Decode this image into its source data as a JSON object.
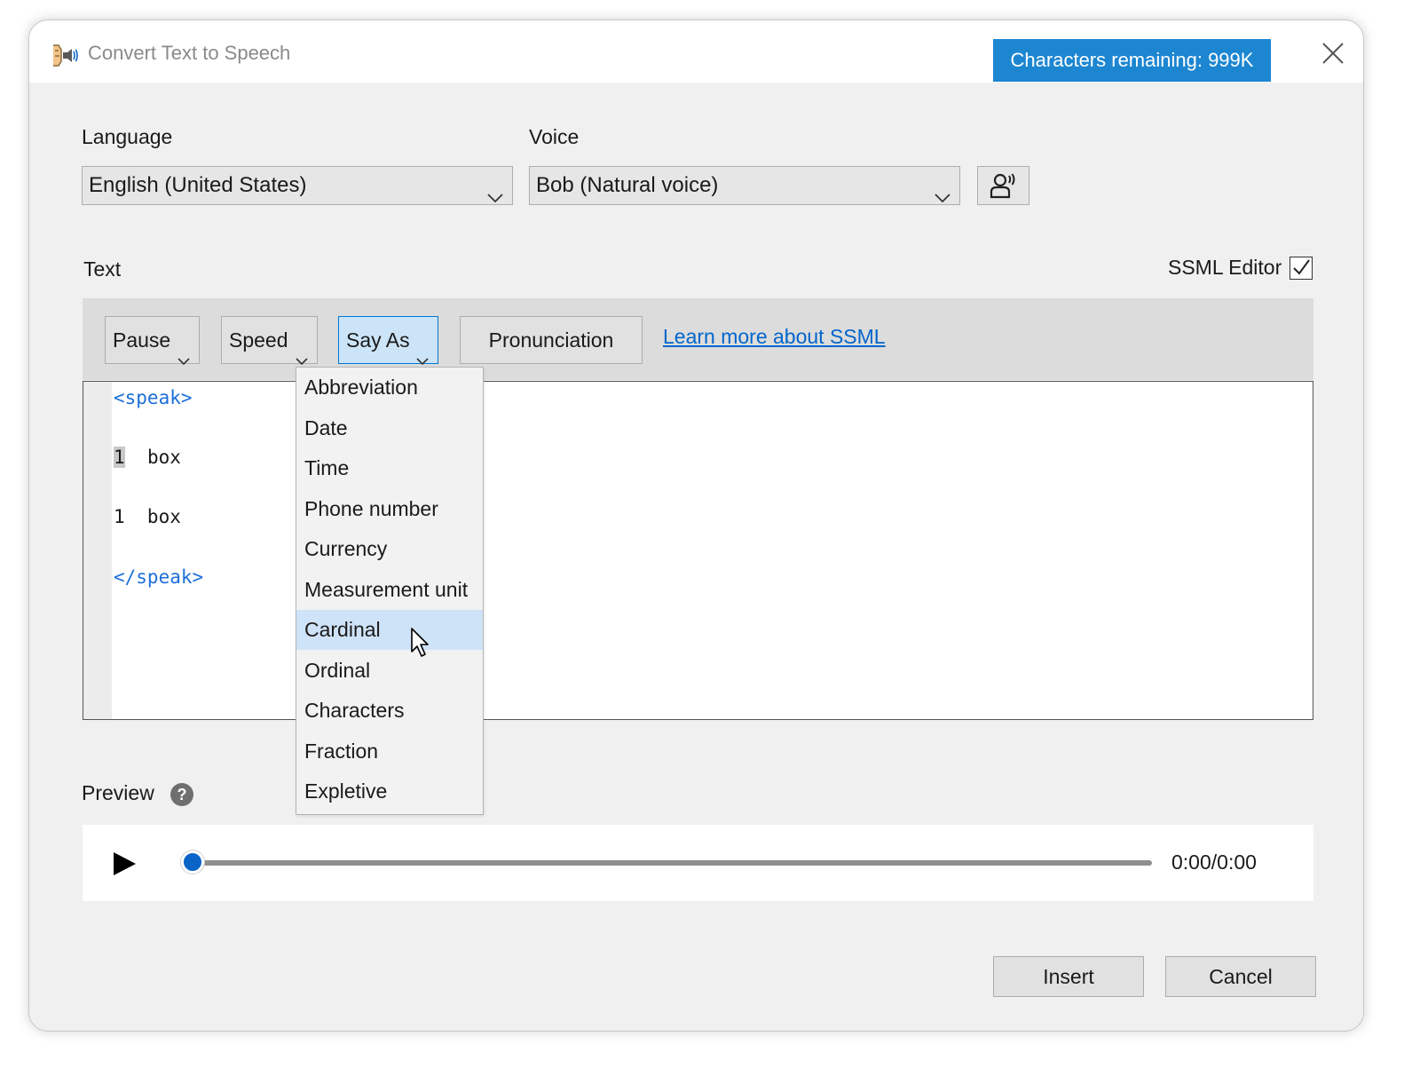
{
  "window": {
    "title": "Convert Text to Speech",
    "app_icon": "speaker-sound-icon",
    "characters_remaining": "Characters remaining: 999K",
    "close_icon": "close-icon"
  },
  "language": {
    "label": "Language",
    "selected": "English (United States)"
  },
  "voice": {
    "label": "Voice",
    "selected": "Bob (Natural voice)",
    "preview_icon": "voice-person-icon"
  },
  "text_section": {
    "label": "Text",
    "ssml_editor_label": "SSML Editor",
    "ssml_editor_checked": true
  },
  "toolbar": {
    "pause": "Pause",
    "speed": "Speed",
    "say_as": "Say As",
    "pronunciation": "Pronunciation",
    "learn_link": "Learn more about SSML"
  },
  "editor": {
    "lines": [
      "<speak>",
      "1",
      "box",
      "1  box",
      "</speak>"
    ]
  },
  "say_as_menu": {
    "items": [
      "Abbreviation",
      "Date",
      "Time",
      "Phone number",
      "Currency",
      "Measurement unit",
      "Cardinal",
      "Ordinal",
      "Characters",
      "Fraction",
      "Expletive"
    ],
    "hovered": "Cardinal"
  },
  "preview": {
    "label": "Preview",
    "help_icon": "question-icon",
    "time": "0:00/0:00",
    "progress": 0
  },
  "footer": {
    "insert": "Insert",
    "cancel": "Cancel"
  },
  "colors": {
    "badge": "#1c86d1",
    "link": "#0066cc",
    "ssml_tag": "#1e6fd9",
    "menu_hover": "#cfe3f8",
    "slider_thumb": "#0a64c8"
  }
}
